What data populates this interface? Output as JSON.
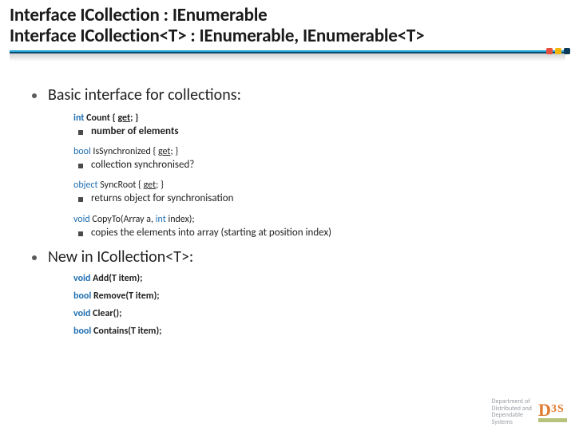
{
  "title": {
    "line1": "Interface ICollection : IEnumerable",
    "line2": "Interface ICollection<T> : IEnumerable, IEnumerable<T>"
  },
  "section1": {
    "heading": "Basic interface for collections:",
    "items": [
      {
        "sig_prefix_kw": "int",
        "sig_mid": " Count { ",
        "sig_uline": "get",
        "sig_suffix": "; }",
        "desc": "number of elements"
      },
      {
        "sig_prefix_kw": "bool",
        "sig_mid": " IsSynchronized { ",
        "sig_uline": "get",
        "sig_suffix": "; }",
        "desc": "collection synchronised?"
      },
      {
        "sig_prefix_kw": "object",
        "sig_mid": " SyncRoot { ",
        "sig_uline": "get",
        "sig_suffix": "; }",
        "desc": "returns object for synchronisation"
      },
      {
        "sig_prefix_kw": "void",
        "sig_mid": " CopyTo(Array a, ",
        "sig_kw2": "int",
        "sig_suffix": " index);",
        "desc": "copies the elements into array (starting at position index)"
      }
    ]
  },
  "section2": {
    "heading": "New in ICollection<T>:",
    "items": [
      {
        "kw": "void",
        "rest": " Add(T item);"
      },
      {
        "kw": "bool",
        "rest": " Remove(T item);"
      },
      {
        "kw": "void",
        "rest": " Clear();"
      },
      {
        "kw": "bool",
        "rest": " Contains(T item);"
      }
    ]
  },
  "footer": {
    "dept_line1": "Department of",
    "dept_line2": "Distributed and",
    "dept_line3": "Dependable",
    "dept_line4": "Systems",
    "logo_d": "D",
    "logo_3": "3",
    "logo_s": "S"
  }
}
